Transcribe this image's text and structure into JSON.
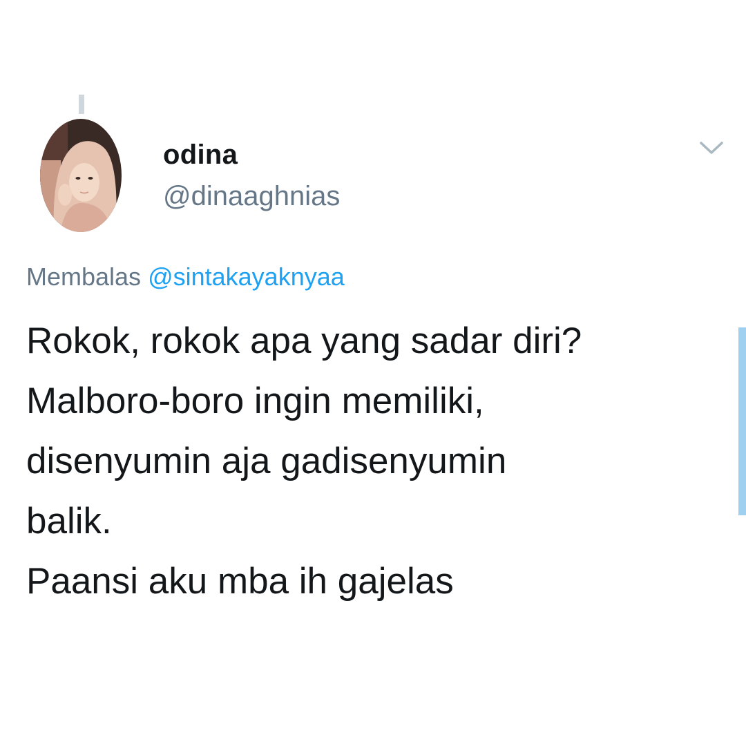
{
  "tweet": {
    "display_name": "odina",
    "handle": "@dinaaghnias",
    "reply_prefix": "Membalas ",
    "reply_mention": "@sintakayaknyaa",
    "body": "Rokok, rokok apa yang sadar diri?\nMalboro-boro ingin memiliki,\ndisenyumin aja gadisenyumin\nbalik.\nPaansi aku mba ih gajelas"
  },
  "icons": {
    "menu": "chevron-down-icon",
    "avatar": "profile-photo"
  },
  "colors": {
    "text_primary": "#14171a",
    "text_secondary": "#657786",
    "link": "#1da1f2",
    "scroll_indicator": "#9fd0f0"
  }
}
